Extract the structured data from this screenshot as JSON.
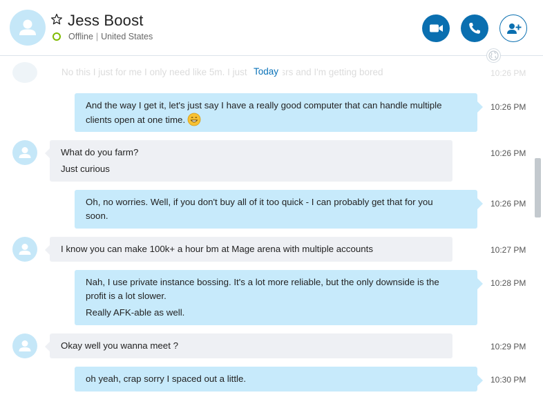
{
  "contact": {
    "name": "Jess Boost",
    "status": "Offline",
    "location": "United States",
    "status_color": "#7fba00"
  },
  "header_buttons": {
    "video_icon": "video-camera-icon",
    "call_icon": "phone-icon",
    "add_icon": "add-person-icon"
  },
  "colors": {
    "accent": "#0a6fb0",
    "outgoing_bubble": "#c7eafb",
    "incoming_bubble": "#eef0f4"
  },
  "separator": {
    "label": "Today"
  },
  "ghost_message": {
    "text": "No this I just for me I only need like 5m. I just h          d of osrs and I'm getting bored",
    "time": "10:26 PM"
  },
  "messages": [
    {
      "direction": "out",
      "lines": [
        "And the way I get it, let's just say I have a really good computer that can handle multiple",
        "clients open at one time."
      ],
      "emoji": "grinning-face-icon",
      "time": "10:26 PM"
    },
    {
      "direction": "in",
      "lines": [
        "What do you farm?",
        "Just curious"
      ],
      "time": "10:26 PM"
    },
    {
      "direction": "out",
      "lines": [
        "Oh, no worries. Well, if you don't buy all of it too quick - I can probably get that for you",
        "soon."
      ],
      "time": "10:26 PM"
    },
    {
      "direction": "in",
      "lines": [
        "I know you can make 100k+ a hour bm at Mage arena with multiple accounts"
      ],
      "time": "10:27 PM"
    },
    {
      "direction": "out",
      "lines": [
        "Nah, I use private instance bossing. It's a lot more reliable, but the only downside is the",
        "profit is a lot slower.",
        "Really AFK-able as well."
      ],
      "time": "10:28 PM"
    },
    {
      "direction": "in",
      "lines": [
        "Okay well you wanna meet ?"
      ],
      "time": "10:29 PM"
    },
    {
      "direction": "out",
      "lines": [
        "oh yeah, crap sorry I spaced out a little."
      ],
      "time": "10:30 PM"
    }
  ]
}
